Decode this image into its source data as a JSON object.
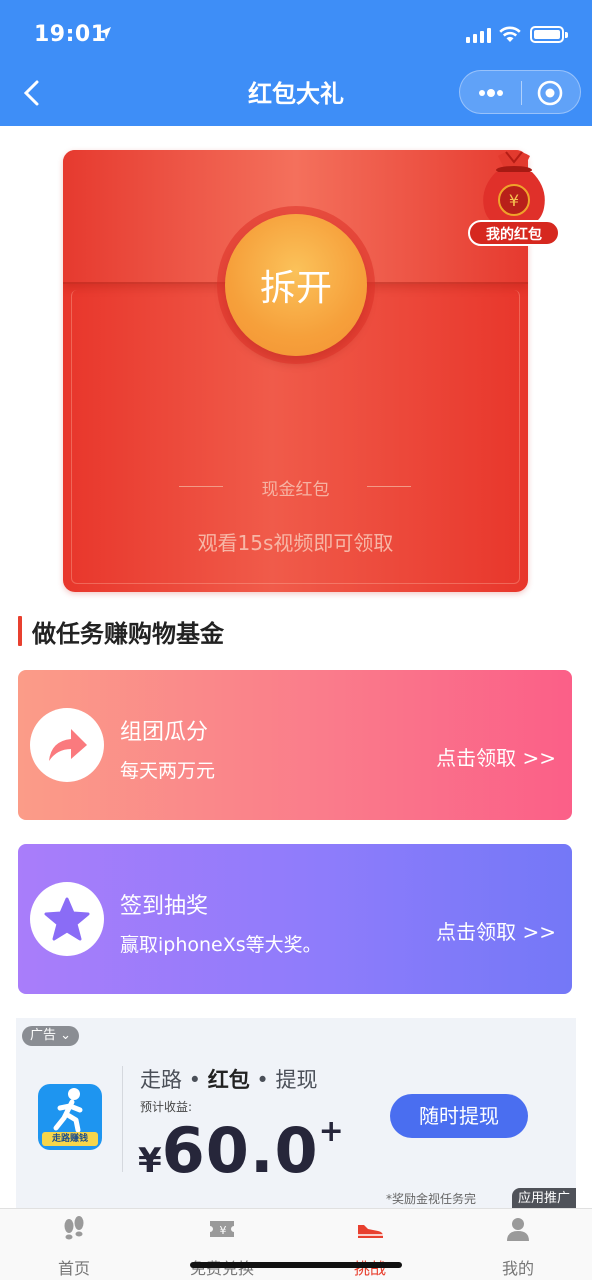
{
  "status": {
    "time": "19:01"
  },
  "nav": {
    "title": "红包大礼"
  },
  "envelope": {
    "open_label": "拆开",
    "subtitle": "现金红包",
    "description": "观看15s视频即可领取",
    "my_redpack_label": "我的红包"
  },
  "section": {
    "title": "做任务赚购物基金"
  },
  "cards": [
    {
      "title": "组团瓜分",
      "subtitle": "每天两万元",
      "cta": "点击领取 >>",
      "icon": "share-arrow-icon"
    },
    {
      "title": "签到抽奖",
      "subtitle": "赢取iphoneXs等大奖。",
      "cta": "点击领取 >>",
      "icon": "star-icon"
    }
  ],
  "ad": {
    "tag": "广告",
    "title_pre": "走路",
    "title_mid": "红包",
    "title_post": "提现",
    "logo_label": "走路赚钱",
    "earn_label": "预计收益:",
    "currency": "¥",
    "amount": "60.0",
    "plus": "+",
    "button": "随时提现",
    "note": "*奖励金视任务完",
    "promo": "应用推广"
  },
  "tabbar": [
    {
      "label": "首页",
      "icon": "footprints-icon"
    },
    {
      "label": "免费兑换",
      "icon": "ticket-icon"
    },
    {
      "label": "挑战",
      "icon": "sneaker-icon",
      "active": true
    },
    {
      "label": "我的",
      "icon": "user-icon"
    }
  ],
  "colors": {
    "nav": "#3e8ef7",
    "envelope": "#e8362b",
    "accent": "#e8402f"
  }
}
